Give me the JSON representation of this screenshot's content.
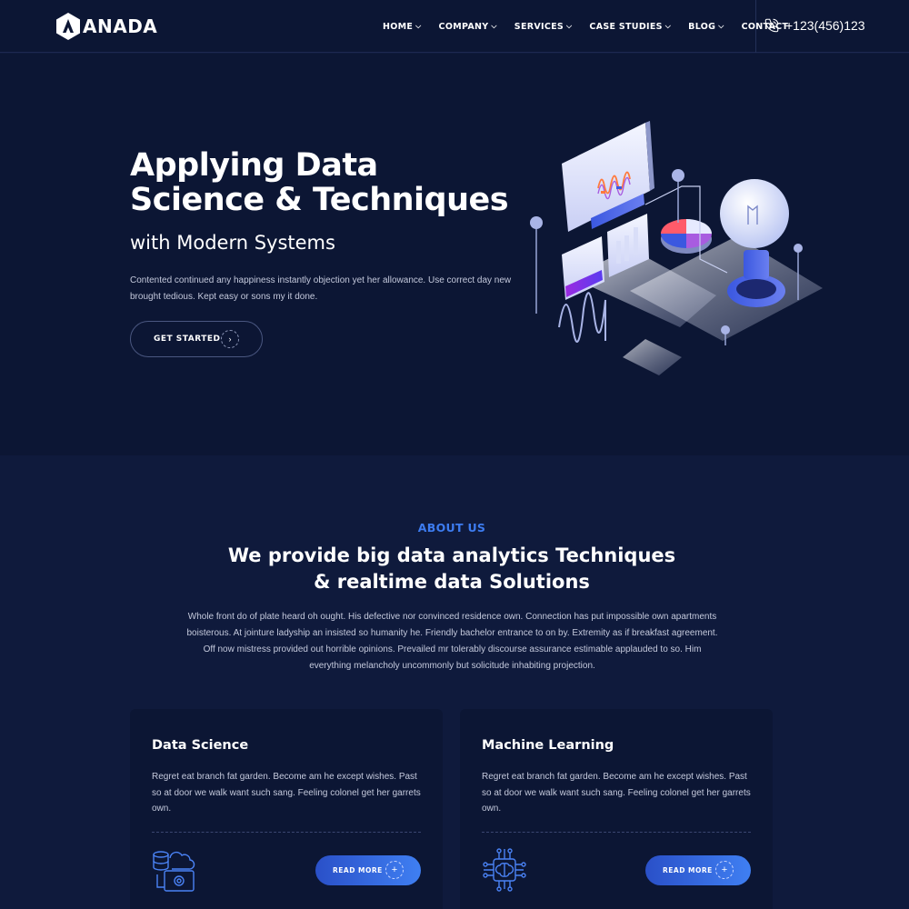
{
  "brand": {
    "name": "ANADA"
  },
  "nav": {
    "items": [
      {
        "label": "HOME",
        "has_dropdown": true
      },
      {
        "label": "COMPANY",
        "has_dropdown": true
      },
      {
        "label": "SERVICES",
        "has_dropdown": true
      },
      {
        "label": "CASE STUDIES",
        "has_dropdown": true
      },
      {
        "label": "BLOG",
        "has_dropdown": true
      },
      {
        "label": "CONTACT",
        "has_dropdown": false
      }
    ],
    "phone": "+123(456)123"
  },
  "hero": {
    "title_line1": "Applying Data",
    "title_line2": "Science & Techniques",
    "subtitle": "with Modern Systems",
    "text": "Contented continued any happiness instantly objection yet her allowance. Use correct day new brought tedious. Kept easy or sons my it done.",
    "button_label": "GET STARTED"
  },
  "about": {
    "tag": "ABOUT US",
    "title_line1": "We provide big data analytics Techniques",
    "title_line2": "& realtime data Solutions",
    "text": "Whole front do of plate heard oh ought. His defective nor convinced residence own. Connection has put impossible own apartments boisterous. At jointure ladyship an insisted so humanity he. Friendly bachelor entrance to on by. Extremity as if breakfast agreement. Off now mistress provided out horrible opinions. Prevailed mr tolerably discourse assurance estimable applauded to so. Him everything melancholy uncommonly but solicitude inhabiting projection."
  },
  "services": [
    {
      "title": "Data Science",
      "text": "Regret eat branch fat garden. Become am he except wishes. Past so at door we walk want such sang. Feeling colonel get her garrets own.",
      "button_label": "READ MORE",
      "icon": "cloud-database-icon"
    },
    {
      "title": "Machine Learning",
      "text": "Regret eat branch fat garden. Become am he except wishes. Past so at door we walk want such sang. Feeling colonel get her garrets own.",
      "button_label": "READ MORE",
      "icon": "brain-chip-icon"
    }
  ],
  "colors": {
    "background": "#0f1a3c",
    "header_bg": "#0c1634",
    "accent": "#3d7cf0",
    "button_gradient_start": "#2a50c8",
    "button_gradient_end": "#3f7ff2"
  }
}
